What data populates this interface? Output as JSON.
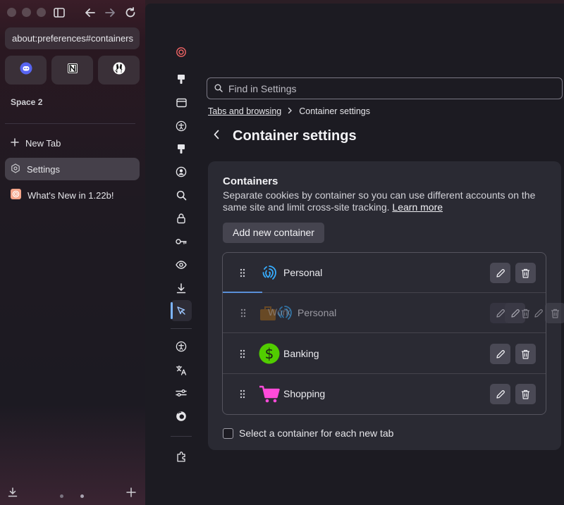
{
  "browser": {
    "url": "about:preferences#containers",
    "space_name": "Space 2",
    "pinned_tabs": [
      {
        "name": "Discord",
        "icon": "discord-icon"
      },
      {
        "name": "Notion",
        "icon": "notion-icon"
      },
      {
        "name": "GitHub",
        "icon": "github-icon"
      }
    ],
    "tabs": [
      {
        "label": "New Tab",
        "icon": "plus-icon"
      },
      {
        "label": "Settings",
        "icon": "gear-icon"
      },
      {
        "label": "What's New in 1.22b!",
        "icon": "zen-logo-icon"
      }
    ]
  },
  "settings": {
    "search_placeholder": "Find in Settings",
    "breadcrumb": {
      "parent": "Tabs and browsing",
      "current": "Container settings"
    },
    "page_title": "Container settings",
    "section": {
      "title": "Containers",
      "description": "Separate cookies by container so you can use different accounts on the same site and limit cross-site tracking.",
      "learn_more": "Learn more",
      "add_button": "Add new container",
      "containers": [
        {
          "name": "Personal",
          "icon": "fingerprint-icon",
          "color": "#37adff"
        },
        {
          "name": "Personal",
          "icon": "fingerprint-icon",
          "color": "#37adff"
        },
        {
          "name": "Banking",
          "icon": "dollar-icon",
          "color": "#51cd00"
        },
        {
          "name": "Shopping",
          "icon": "cart-icon",
          "color": "#ff4bda"
        }
      ],
      "ghost_container": {
        "name": "Work",
        "icon": "briefcase-icon",
        "color": "#ff9f00"
      },
      "checkbox_label": "Select a container for each new tab",
      "checkbox_checked": false
    }
  },
  "colors": {
    "accent": "#7cb4ff",
    "panel": "#1c1b22",
    "card": "#2a2a33"
  }
}
